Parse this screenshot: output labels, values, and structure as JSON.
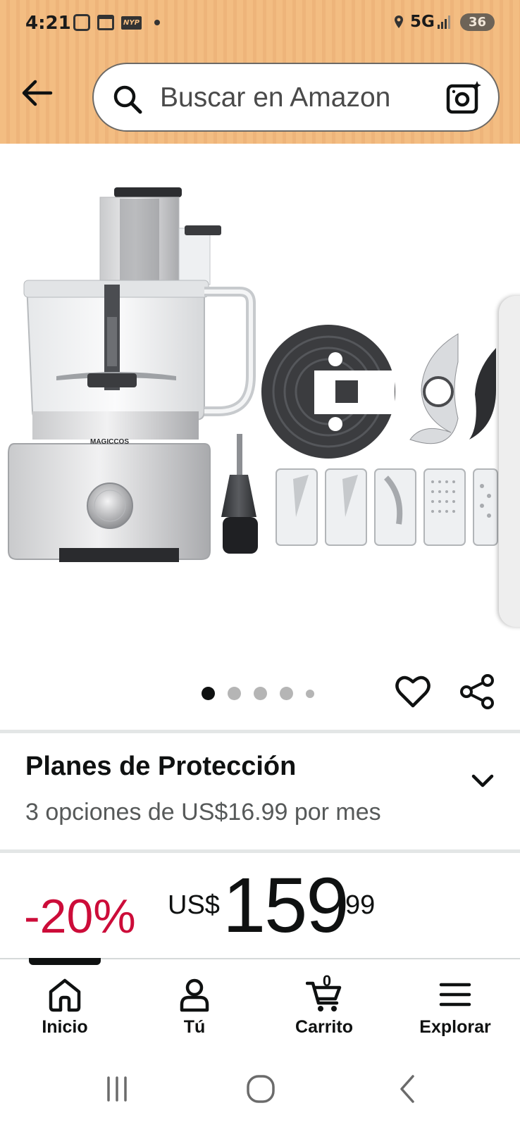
{
  "status_bar": {
    "time": "4:21",
    "notification_badge": "NYP",
    "network": "5G",
    "battery": "36"
  },
  "search": {
    "placeholder": "Buscar en Amazon"
  },
  "product": {
    "brand_on_image": "MAGICCOS",
    "image_count": 5,
    "current_image_index": 1
  },
  "protection": {
    "title": "Planes de Protección",
    "subtitle": "3 opciones de US$16.99 por mes"
  },
  "price": {
    "discount": "-20%",
    "currency": "US$",
    "whole": "159",
    "fraction": "99"
  },
  "bottom_nav": {
    "items": [
      {
        "label": "Inicio",
        "icon": "home-icon",
        "active": true
      },
      {
        "label": "Tú",
        "icon": "person-icon"
      },
      {
        "label": "Carrito",
        "icon": "cart-icon",
        "count": "0"
      },
      {
        "label": "Explorar",
        "icon": "menu-icon"
      }
    ]
  },
  "colors": {
    "header_bg": "#f3bd82",
    "discount": "#cc0c39",
    "text": "#0f1111",
    "secondary_text": "#565959"
  }
}
